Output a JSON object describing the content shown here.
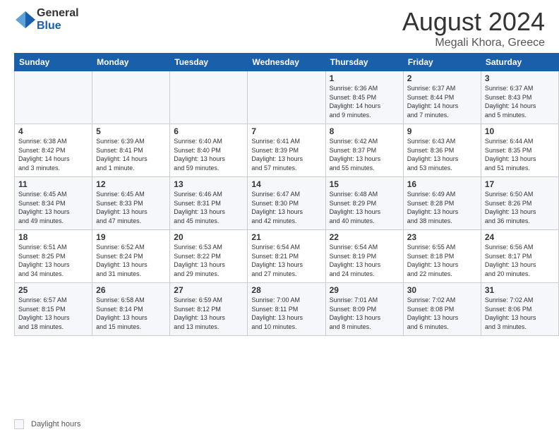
{
  "header": {
    "logo_general": "General",
    "logo_blue": "Blue",
    "month_year": "August 2024",
    "location": "Megali Khora, Greece"
  },
  "weekdays": [
    "Sunday",
    "Monday",
    "Tuesday",
    "Wednesday",
    "Thursday",
    "Friday",
    "Saturday"
  ],
  "weeks": [
    [
      {
        "day": "",
        "info": ""
      },
      {
        "day": "",
        "info": ""
      },
      {
        "day": "",
        "info": ""
      },
      {
        "day": "",
        "info": ""
      },
      {
        "day": "1",
        "info": "Sunrise: 6:36 AM\nSunset: 8:45 PM\nDaylight: 14 hours\nand 9 minutes."
      },
      {
        "day": "2",
        "info": "Sunrise: 6:37 AM\nSunset: 8:44 PM\nDaylight: 14 hours\nand 7 minutes."
      },
      {
        "day": "3",
        "info": "Sunrise: 6:37 AM\nSunset: 8:43 PM\nDaylight: 14 hours\nand 5 minutes."
      }
    ],
    [
      {
        "day": "4",
        "info": "Sunrise: 6:38 AM\nSunset: 8:42 PM\nDaylight: 14 hours\nand 3 minutes."
      },
      {
        "day": "5",
        "info": "Sunrise: 6:39 AM\nSunset: 8:41 PM\nDaylight: 14 hours\nand 1 minute."
      },
      {
        "day": "6",
        "info": "Sunrise: 6:40 AM\nSunset: 8:40 PM\nDaylight: 13 hours\nand 59 minutes."
      },
      {
        "day": "7",
        "info": "Sunrise: 6:41 AM\nSunset: 8:39 PM\nDaylight: 13 hours\nand 57 minutes."
      },
      {
        "day": "8",
        "info": "Sunrise: 6:42 AM\nSunset: 8:37 PM\nDaylight: 13 hours\nand 55 minutes."
      },
      {
        "day": "9",
        "info": "Sunrise: 6:43 AM\nSunset: 8:36 PM\nDaylight: 13 hours\nand 53 minutes."
      },
      {
        "day": "10",
        "info": "Sunrise: 6:44 AM\nSunset: 8:35 PM\nDaylight: 13 hours\nand 51 minutes."
      }
    ],
    [
      {
        "day": "11",
        "info": "Sunrise: 6:45 AM\nSunset: 8:34 PM\nDaylight: 13 hours\nand 49 minutes."
      },
      {
        "day": "12",
        "info": "Sunrise: 6:45 AM\nSunset: 8:33 PM\nDaylight: 13 hours\nand 47 minutes."
      },
      {
        "day": "13",
        "info": "Sunrise: 6:46 AM\nSunset: 8:31 PM\nDaylight: 13 hours\nand 45 minutes."
      },
      {
        "day": "14",
        "info": "Sunrise: 6:47 AM\nSunset: 8:30 PM\nDaylight: 13 hours\nand 42 minutes."
      },
      {
        "day": "15",
        "info": "Sunrise: 6:48 AM\nSunset: 8:29 PM\nDaylight: 13 hours\nand 40 minutes."
      },
      {
        "day": "16",
        "info": "Sunrise: 6:49 AM\nSunset: 8:28 PM\nDaylight: 13 hours\nand 38 minutes."
      },
      {
        "day": "17",
        "info": "Sunrise: 6:50 AM\nSunset: 8:26 PM\nDaylight: 13 hours\nand 36 minutes."
      }
    ],
    [
      {
        "day": "18",
        "info": "Sunrise: 6:51 AM\nSunset: 8:25 PM\nDaylight: 13 hours\nand 34 minutes."
      },
      {
        "day": "19",
        "info": "Sunrise: 6:52 AM\nSunset: 8:24 PM\nDaylight: 13 hours\nand 31 minutes."
      },
      {
        "day": "20",
        "info": "Sunrise: 6:53 AM\nSunset: 8:22 PM\nDaylight: 13 hours\nand 29 minutes."
      },
      {
        "day": "21",
        "info": "Sunrise: 6:54 AM\nSunset: 8:21 PM\nDaylight: 13 hours\nand 27 minutes."
      },
      {
        "day": "22",
        "info": "Sunrise: 6:54 AM\nSunset: 8:19 PM\nDaylight: 13 hours\nand 24 minutes."
      },
      {
        "day": "23",
        "info": "Sunrise: 6:55 AM\nSunset: 8:18 PM\nDaylight: 13 hours\nand 22 minutes."
      },
      {
        "day": "24",
        "info": "Sunrise: 6:56 AM\nSunset: 8:17 PM\nDaylight: 13 hours\nand 20 minutes."
      }
    ],
    [
      {
        "day": "25",
        "info": "Sunrise: 6:57 AM\nSunset: 8:15 PM\nDaylight: 13 hours\nand 18 minutes."
      },
      {
        "day": "26",
        "info": "Sunrise: 6:58 AM\nSunset: 8:14 PM\nDaylight: 13 hours\nand 15 minutes."
      },
      {
        "day": "27",
        "info": "Sunrise: 6:59 AM\nSunset: 8:12 PM\nDaylight: 13 hours\nand 13 minutes."
      },
      {
        "day": "28",
        "info": "Sunrise: 7:00 AM\nSunset: 8:11 PM\nDaylight: 13 hours\nand 10 minutes."
      },
      {
        "day": "29",
        "info": "Sunrise: 7:01 AM\nSunset: 8:09 PM\nDaylight: 13 hours\nand 8 minutes."
      },
      {
        "day": "30",
        "info": "Sunrise: 7:02 AM\nSunset: 8:08 PM\nDaylight: 13 hours\nand 6 minutes."
      },
      {
        "day": "31",
        "info": "Sunrise: 7:02 AM\nSunset: 8:06 PM\nDaylight: 13 hours\nand 3 minutes."
      }
    ]
  ],
  "footer": {
    "legend_label": "Daylight hours"
  }
}
